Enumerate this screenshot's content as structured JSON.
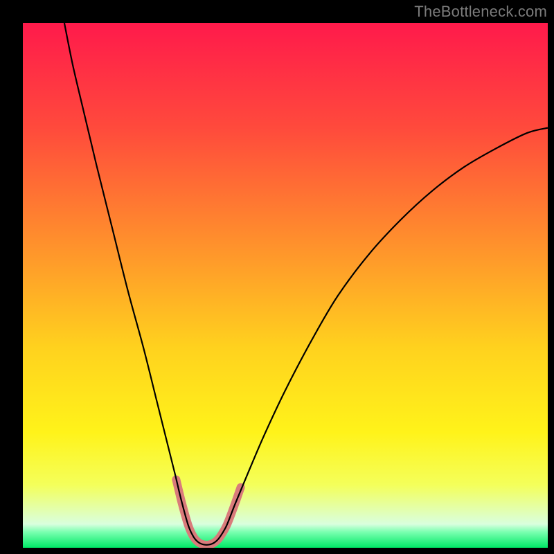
{
  "watermark": "TheBottleneck.com",
  "chart_data": {
    "type": "line",
    "title": "",
    "xlabel": "",
    "ylabel": "",
    "xlim": [
      0,
      100
    ],
    "ylim": [
      0,
      100
    ],
    "gradient_stops": [
      {
        "offset": 0.0,
        "color": "#ff1a4b"
      },
      {
        "offset": 0.2,
        "color": "#ff4a3c"
      },
      {
        "offset": 0.45,
        "color": "#ff9a2a"
      },
      {
        "offset": 0.62,
        "color": "#ffd21e"
      },
      {
        "offset": 0.78,
        "color": "#fff31a"
      },
      {
        "offset": 0.88,
        "color": "#f4ff5a"
      },
      {
        "offset": 0.955,
        "color": "#d9ffde"
      },
      {
        "offset": 0.97,
        "color": "#7affb0"
      },
      {
        "offset": 1.0,
        "color": "#00ea66"
      }
    ],
    "series": [
      {
        "name": "bottleneck-curve",
        "stroke": "#000000",
        "stroke_width": 2.2,
        "points": [
          {
            "x": 7.9,
            "y": 100.0
          },
          {
            "x": 9.5,
            "y": 92.0
          },
          {
            "x": 11.5,
            "y": 83.5
          },
          {
            "x": 14.0,
            "y": 73.0
          },
          {
            "x": 17.0,
            "y": 61.0
          },
          {
            "x": 20.0,
            "y": 49.0
          },
          {
            "x": 23.0,
            "y": 38.0
          },
          {
            "x": 25.5,
            "y": 28.0
          },
          {
            "x": 27.5,
            "y": 20.0
          },
          {
            "x": 29.0,
            "y": 14.0
          },
          {
            "x": 30.2,
            "y": 9.0
          },
          {
            "x": 31.5,
            "y": 4.3
          },
          {
            "x": 32.5,
            "y": 2.1
          },
          {
            "x": 33.5,
            "y": 1.0
          },
          {
            "x": 34.5,
            "y": 0.6
          },
          {
            "x": 35.5,
            "y": 0.6
          },
          {
            "x": 36.5,
            "y": 1.0
          },
          {
            "x": 37.5,
            "y": 2.0
          },
          {
            "x": 38.8,
            "y": 4.2
          },
          {
            "x": 40.5,
            "y": 8.5
          },
          {
            "x": 43.0,
            "y": 14.5
          },
          {
            "x": 46.0,
            "y": 21.5
          },
          {
            "x": 50.0,
            "y": 30.0
          },
          {
            "x": 55.0,
            "y": 39.5
          },
          {
            "x": 60.0,
            "y": 48.0
          },
          {
            "x": 66.0,
            "y": 56.0
          },
          {
            "x": 72.0,
            "y": 62.5
          },
          {
            "x": 78.0,
            "y": 68.0
          },
          {
            "x": 84.0,
            "y": 72.5
          },
          {
            "x": 90.0,
            "y": 76.0
          },
          {
            "x": 96.0,
            "y": 79.0
          },
          {
            "x": 100.0,
            "y": 80.0
          }
        ]
      },
      {
        "name": "valley-highlight",
        "stroke": "#d97b7b",
        "stroke_width": 12,
        "linecap": "round",
        "points": [
          {
            "x": 29.2,
            "y": 13.0
          },
          {
            "x": 30.3,
            "y": 8.5
          },
          {
            "x": 31.5,
            "y": 4.3
          },
          {
            "x": 32.5,
            "y": 2.1
          },
          {
            "x": 33.5,
            "y": 1.0
          },
          {
            "x": 34.5,
            "y": 0.6
          },
          {
            "x": 35.5,
            "y": 0.6
          },
          {
            "x": 36.5,
            "y": 1.0
          },
          {
            "x": 37.5,
            "y": 2.0
          },
          {
            "x": 38.8,
            "y": 4.2
          },
          {
            "x": 40.2,
            "y": 7.8
          },
          {
            "x": 41.5,
            "y": 11.5
          }
        ]
      }
    ]
  }
}
